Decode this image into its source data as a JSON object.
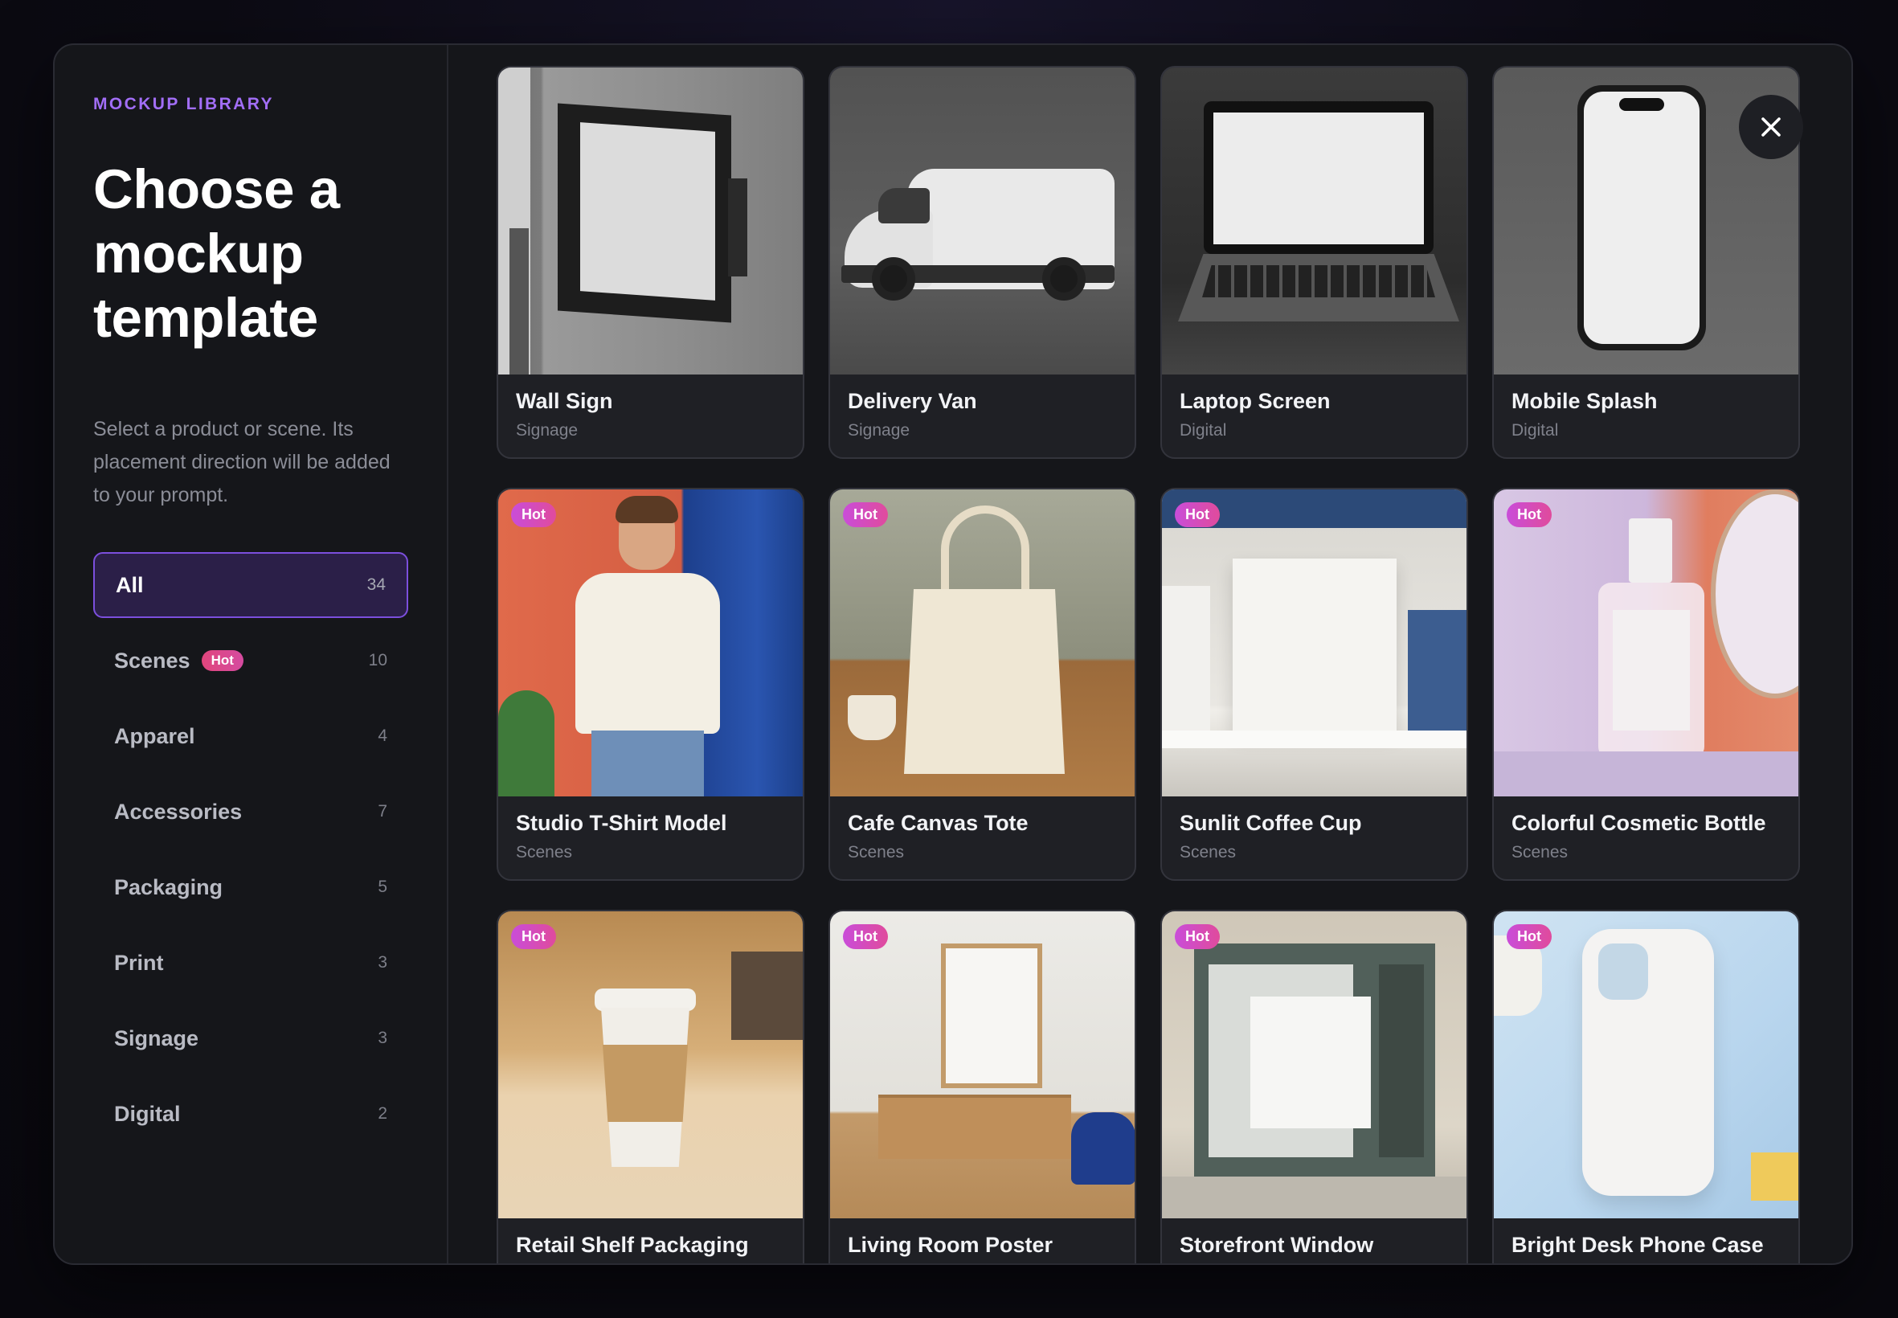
{
  "sidebar": {
    "eyebrow": "MOCKUP LIBRARY",
    "title": "Choose a mockup template",
    "description": "Select a product or scene. Its placement direction will be added to your prompt.",
    "categories": [
      {
        "label": "All",
        "count": "34",
        "active": true,
        "hot": false
      },
      {
        "label": "Scenes",
        "count": "10",
        "active": false,
        "hot": true
      },
      {
        "label": "Apparel",
        "count": "4",
        "active": false,
        "hot": false
      },
      {
        "label": "Accessories",
        "count": "7",
        "active": false,
        "hot": false
      },
      {
        "label": "Packaging",
        "count": "5",
        "active": false,
        "hot": false
      },
      {
        "label": "Print",
        "count": "3",
        "active": false,
        "hot": false
      },
      {
        "label": "Signage",
        "count": "3",
        "active": false,
        "hot": false
      },
      {
        "label": "Digital",
        "count": "2",
        "active": false,
        "hot": false
      }
    ],
    "hot_label": "Hot"
  },
  "hot_badge": "Hot",
  "cards": [
    {
      "name": "Wall Sign",
      "category": "Signage",
      "hot": false,
      "image": "wall-sign"
    },
    {
      "name": "Delivery Van",
      "category": "Signage",
      "hot": false,
      "image": "delivery-van"
    },
    {
      "name": "Laptop Screen",
      "category": "Digital",
      "hot": false,
      "image": "laptop-screen"
    },
    {
      "name": "Mobile Splash",
      "category": "Digital",
      "hot": false,
      "image": "mobile-splash"
    },
    {
      "name": "Studio T-Shirt Model",
      "category": "Scenes",
      "hot": true,
      "image": "tshirt-model"
    },
    {
      "name": "Cafe Canvas Tote",
      "category": "Scenes",
      "hot": true,
      "image": "canvas-tote"
    },
    {
      "name": "Sunlit Coffee Cup",
      "category": "Scenes",
      "hot": true,
      "image": "shelf-box"
    },
    {
      "name": "Colorful Cosmetic Bottle",
      "category": "Scenes",
      "hot": true,
      "image": "cosmetic-bottle"
    },
    {
      "name": "Retail Shelf Packaging",
      "category": "",
      "hot": true,
      "image": "coffee-cup"
    },
    {
      "name": "Living Room Poster",
      "category": "",
      "hot": true,
      "image": "poster"
    },
    {
      "name": "Storefront Window",
      "category": "",
      "hot": true,
      "image": "storefront"
    },
    {
      "name": "Bright Desk Phone Case",
      "category": "",
      "hot": true,
      "image": "phone-case"
    }
  ],
  "close_icon": "close-icon",
  "colors": {
    "accent": "#a26ef7",
    "active_bg": "#2b1f48",
    "active_border": "#7c4fdd",
    "hot_pink": "#e0457c"
  }
}
